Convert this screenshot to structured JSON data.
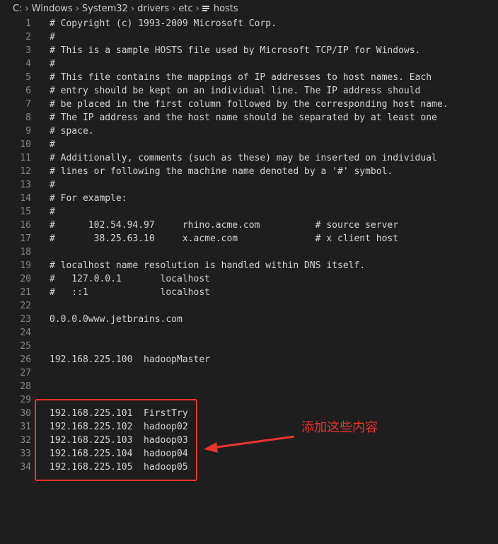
{
  "breadcrumb": {
    "segments": [
      "C:",
      "Windows",
      "System32",
      "drivers",
      "etc"
    ],
    "file": "hosts",
    "file_icon": "list-lines-icon"
  },
  "lines": [
    {
      "num": "1",
      "text": "# Copyright (c) 1993-2009 Microsoft Corp."
    },
    {
      "num": "2",
      "text": "#"
    },
    {
      "num": "3",
      "text": "# This is a sample HOSTS file used by Microsoft TCP/IP for Windows."
    },
    {
      "num": "4",
      "text": "#"
    },
    {
      "num": "5",
      "text": "# This file contains the mappings of IP addresses to host names. Each"
    },
    {
      "num": "6",
      "text": "# entry should be kept on an individual line. The IP address should"
    },
    {
      "num": "7",
      "text": "# be placed in the first column followed by the corresponding host name."
    },
    {
      "num": "8",
      "text": "# The IP address and the host name should be separated by at least one"
    },
    {
      "num": "9",
      "text": "# space."
    },
    {
      "num": "10",
      "text": "#"
    },
    {
      "num": "11",
      "text": "# Additionally, comments (such as these) may be inserted on individual"
    },
    {
      "num": "12",
      "text": "# lines or following the machine name denoted by a '#' symbol."
    },
    {
      "num": "13",
      "text": "#"
    },
    {
      "num": "14",
      "text": "# For example:"
    },
    {
      "num": "15",
      "text": "#"
    },
    {
      "num": "16",
      "text": "#      102.54.94.97     rhino.acme.com          # source server"
    },
    {
      "num": "17",
      "text": "#       38.25.63.10     x.acme.com              # x client host"
    },
    {
      "num": "18",
      "text": ""
    },
    {
      "num": "19",
      "text": "# localhost name resolution is handled within DNS itself."
    },
    {
      "num": "20",
      "text": "#   127.0.0.1       localhost"
    },
    {
      "num": "21",
      "text": "#   ::1             localhost"
    },
    {
      "num": "22",
      "text": ""
    },
    {
      "num": "23",
      "text": "0.0.0.0www.jetbrains.com"
    },
    {
      "num": "24",
      "text": ""
    },
    {
      "num": "25",
      "text": ""
    },
    {
      "num": "26",
      "text": "192.168.225.100  hadoopMaster"
    },
    {
      "num": "27",
      "text": ""
    },
    {
      "num": "28",
      "text": ""
    },
    {
      "num": "29",
      "text": ""
    },
    {
      "num": "30",
      "text": "192.168.225.101  FirstTry"
    },
    {
      "num": "31",
      "text": "192.168.225.102  hadoop02"
    },
    {
      "num": "32",
      "text": "192.168.225.103  hadoop03"
    },
    {
      "num": "33",
      "text": "192.168.225.104  hadoop04"
    },
    {
      "num": "34",
      "text": "192.168.225.105  hadoop05"
    }
  ],
  "annotation": {
    "text": "添加这些内容",
    "color": "#e8342c"
  },
  "colors": {
    "background": "#1e1e1e",
    "text": "#d4d4d4",
    "line_number": "#858585",
    "annotation": "#e8342c"
  }
}
